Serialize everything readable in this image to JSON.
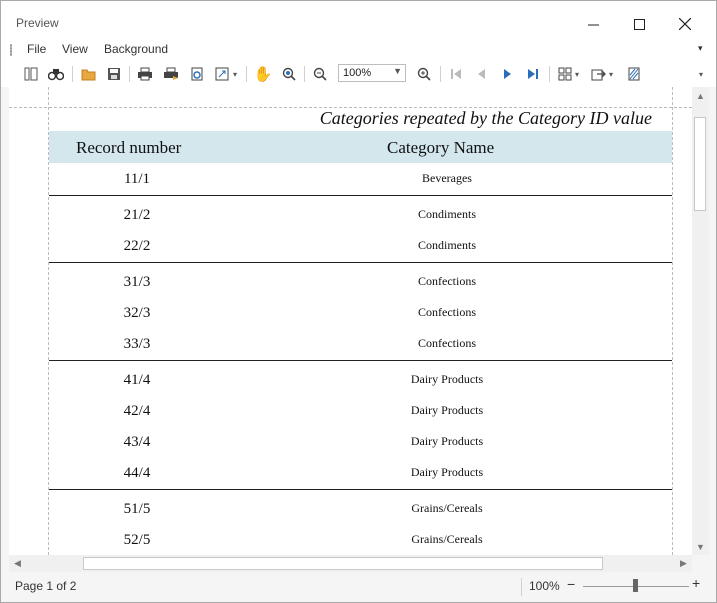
{
  "window": {
    "title": "Preview",
    "minimize_icon": "minimize-icon",
    "maximize_icon": "maximize-icon",
    "close_icon": "close-icon"
  },
  "menu": {
    "file": "File",
    "view": "View",
    "background": "Background"
  },
  "toolbar": {
    "zoom_value": "100%"
  },
  "report": {
    "title": "Categories repeated by the Category ID value",
    "col_record": "Record number",
    "col_category": "Category Name",
    "groups": [
      [
        {
          "record": "11/1",
          "category": "Beverages"
        }
      ],
      [
        {
          "record": "21/2",
          "category": "Condiments"
        },
        {
          "record": "22/2",
          "category": "Condiments"
        }
      ],
      [
        {
          "record": "31/3",
          "category": "Confections"
        },
        {
          "record": "32/3",
          "category": "Confections"
        },
        {
          "record": "33/3",
          "category": "Confections"
        }
      ],
      [
        {
          "record": "41/4",
          "category": "Dairy Products"
        },
        {
          "record": "42/4",
          "category": "Dairy Products"
        },
        {
          "record": "43/4",
          "category": "Dairy Products"
        },
        {
          "record": "44/4",
          "category": "Dairy Products"
        }
      ],
      [
        {
          "record": "51/5",
          "category": "Grains/Cereals"
        },
        {
          "record": "52/5",
          "category": "Grains/Cereals"
        }
      ]
    ]
  },
  "status": {
    "page": "Page 1 of 2",
    "zoom": "100%",
    "zoom_level_percent": 50
  }
}
